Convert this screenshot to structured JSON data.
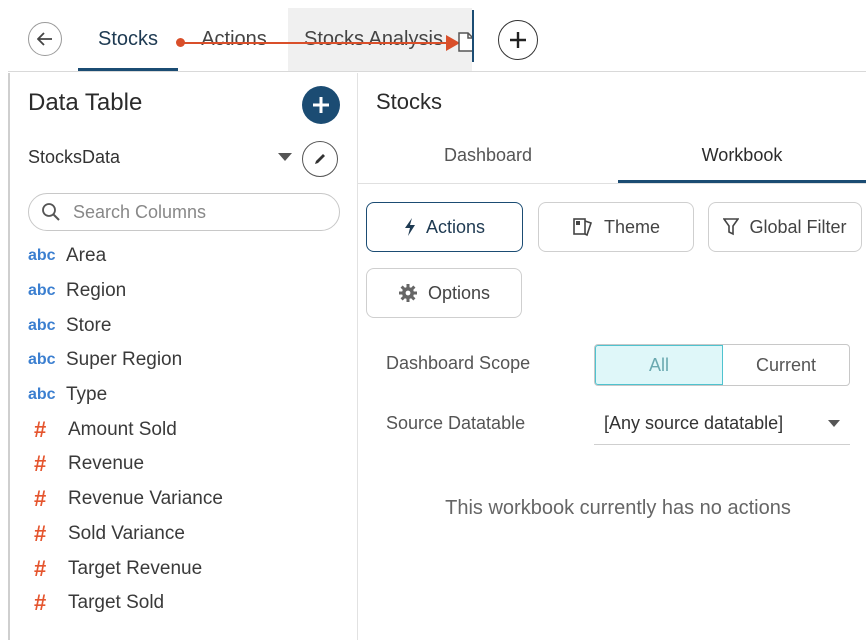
{
  "topbar": {
    "tabs": [
      {
        "label": "Stocks",
        "active": true
      },
      {
        "label": "Actions",
        "active": false
      },
      {
        "label": "Stocks Analysis",
        "active": false
      }
    ],
    "back_icon": "arrow-left-icon",
    "add_icon": "plus-icon"
  },
  "left_panel": {
    "title": "Data Table",
    "datasource": "StocksData",
    "search_placeholder": "Search Columns",
    "columns": [
      {
        "type_label": "abc",
        "name": "Area"
      },
      {
        "type_label": "abc",
        "name": "Region"
      },
      {
        "type_label": "abc",
        "name": "Store"
      },
      {
        "type_label": "abc",
        "name": "Super Region"
      },
      {
        "type_label": "abc",
        "name": "Type"
      },
      {
        "type_label": "#",
        "name": "Amount Sold"
      },
      {
        "type_label": "#",
        "name": "Revenue"
      },
      {
        "type_label": "#",
        "name": "Revenue Variance"
      },
      {
        "type_label": "#",
        "name": "Sold Variance"
      },
      {
        "type_label": "#",
        "name": "Target Revenue"
      },
      {
        "type_label": "#",
        "name": "Target Sold"
      }
    ]
  },
  "right_panel": {
    "title": "Stocks",
    "tabs": [
      {
        "label": "Dashboard",
        "active": false
      },
      {
        "label": "Workbook",
        "active": true
      }
    ],
    "buttons": {
      "actions": "Actions",
      "theme": "Theme",
      "global_filter": "Global Filter",
      "options": "Options"
    },
    "dashboard_scope": {
      "label": "Dashboard Scope",
      "options": [
        "All",
        "Current"
      ],
      "selected": "All"
    },
    "source_datatable": {
      "label": "Source Datatable",
      "value": "[Any source datatable]"
    },
    "empty_message": "This workbook currently has no actions"
  },
  "colors": {
    "accent": "#1b4c73",
    "drag_indicator": "#d94f2a",
    "text_type": "#3b7fd0",
    "numeric_type": "#e5552e",
    "scope_selected_bg": "#dff7f9",
    "scope_selected_border": "#4fc3cf"
  }
}
